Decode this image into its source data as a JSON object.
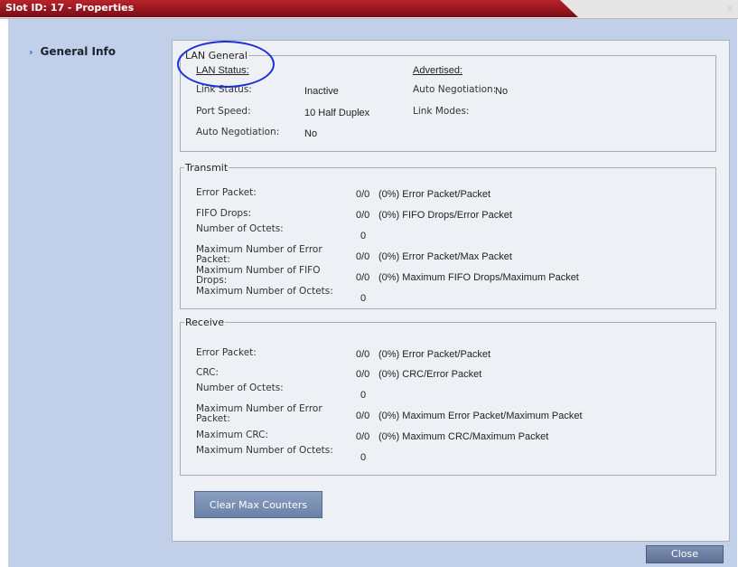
{
  "window": {
    "title": "Slot ID: 17 - Properties",
    "close_glyph": "×"
  },
  "nav": {
    "items": [
      {
        "label": "General Info",
        "icon": "chevron-right-icon"
      }
    ]
  },
  "lan_general": {
    "legend": "LAN General",
    "lan_status_heading": "LAN Status:",
    "advertised_heading": "Advertised:",
    "link_status_label": "Link Status:",
    "link_status_value": "Inactive",
    "port_speed_label": "Port Speed:",
    "port_speed_value": "10 Half Duplex",
    "auto_neg_label": "Auto Negotiation:",
    "auto_neg_value": "No",
    "adv_auto_neg_label": "Auto Negotiation:",
    "adv_auto_neg_value": "No",
    "link_modes_label": "Link Modes:"
  },
  "transmit": {
    "legend": "Transmit",
    "rows": [
      {
        "label": "Error Packet:",
        "value": "0/0",
        "desc": "(0%) Error Packet/Packet"
      },
      {
        "label": "FIFO Drops:",
        "value": "0/0",
        "desc": "(0%) FIFO Drops/Error Packet"
      },
      {
        "label": "Number of Octets:",
        "value": "0",
        "desc": ""
      },
      {
        "label": "Maximum Number of Error Packet:",
        "value": "0/0",
        "desc": "(0%) Error Packet/Max Packet"
      },
      {
        "label": "Maximum Number of FIFO Drops:",
        "value": "0/0",
        "desc": "(0%) Maximum FIFO Drops/Maximum Packet"
      },
      {
        "label": "Maximum Number of Octets:",
        "value": "0",
        "desc": ""
      }
    ]
  },
  "receive": {
    "legend": "Receive",
    "rows": [
      {
        "label": "Error Packet:",
        "value": "0/0",
        "desc": "(0%) Error Packet/Packet"
      },
      {
        "label": "CRC:",
        "value": "0/0",
        "desc": "(0%) CRC/Error Packet"
      },
      {
        "label": "Number of Octets:",
        "value": "0",
        "desc": ""
      },
      {
        "label": "Maximum Number of Error Packet:",
        "value": "0/0",
        "desc": "(0%) Maximum Error Packet/Maximum Packet"
      },
      {
        "label": "Maximum CRC:",
        "value": "0/0",
        "desc": "(0%) Maximum CRC/Maximum Packet"
      },
      {
        "label": "Maximum Number of Octets:",
        "value": "0",
        "desc": ""
      }
    ]
  },
  "buttons": {
    "clear_max_counters": "Clear Max Counters",
    "close": "Close"
  },
  "colors": {
    "title_red": "#b8232b",
    "window_bg": "#c2cfe8",
    "panel_bg": "#edf0f5",
    "button_blue": "#6a80a5",
    "highlight_circle": "#1f2fd6"
  }
}
